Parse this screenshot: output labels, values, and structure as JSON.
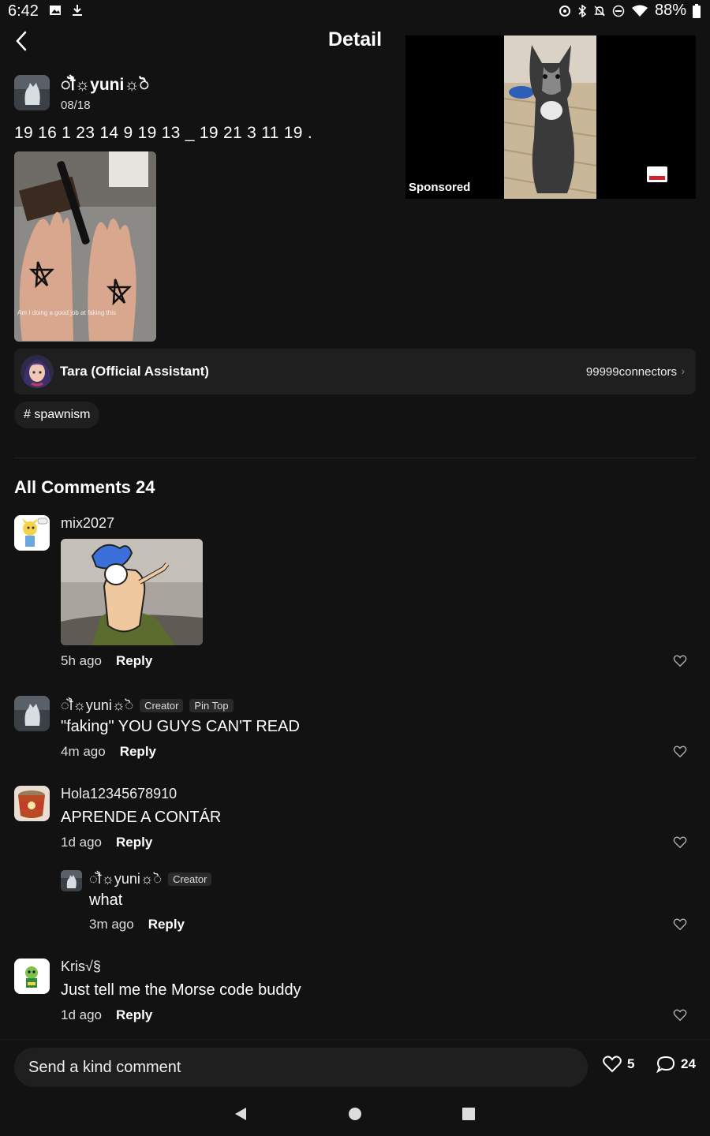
{
  "status_bar": {
    "time": "6:42",
    "battery": "88%"
  },
  "header": {
    "title": "Detail"
  },
  "ad": {
    "label": "Sponsored"
  },
  "post": {
    "author": "ॏ☼yuni☼ॆ",
    "date": "08/18",
    "text": "19 16 1 23 14 9 19 13 _ 19 21 3 11 19 .",
    "image_caption": "Am I doing a good job at faking this"
  },
  "assistant": {
    "name": "Tara (Official Assistant)",
    "link": "99999connectors"
  },
  "tag": {
    "label": "# spawnism"
  },
  "comments_header": {
    "label": "All Comments",
    "count": "24"
  },
  "comments": [
    {
      "user": "mix2027",
      "time": "5h ago",
      "reply": "Reply"
    },
    {
      "user": "ॏ☼yuni☼ॆ",
      "badge1": "Creator",
      "badge2": "Pin Top",
      "text": "\"faking\" YOU GUYS CAN'T READ",
      "time": "4m ago",
      "reply": "Reply"
    },
    {
      "user": "Hola12345678910",
      "text": "APRENDE A CONTÁR",
      "time": "1d ago",
      "reply": "Reply"
    },
    {
      "user": "ॏ☼yuni☼ॆ",
      "badge1": "Creator",
      "text": "what",
      "time": "3m ago",
      "reply": "Reply"
    },
    {
      "user": "Kris√§",
      "text": "Just tell me the Morse code buddy",
      "time": "1d ago",
      "reply": "Reply"
    }
  ],
  "bottom": {
    "placeholder": "Send a kind comment",
    "likes": "5",
    "comments": "24"
  }
}
